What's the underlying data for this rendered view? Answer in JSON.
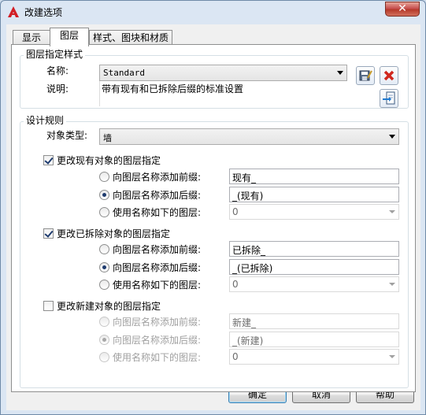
{
  "window": {
    "title": "改建选项",
    "close_glyph": "✕"
  },
  "tabs": [
    {
      "label": "显示"
    },
    {
      "label": "图层"
    },
    {
      "label": "样式、图块和材质"
    }
  ],
  "layer_style": {
    "group_title": "图层指定样式",
    "name_label": "名称:",
    "name_value": "Standard",
    "desc_label": "说明:",
    "desc_value": "带有现有和已拆除后缀的标准设置"
  },
  "rules": {
    "group_title": "设计规则",
    "object_type_label": "对象类型:",
    "object_type_value": "墙",
    "sections": [
      {
        "title": "更改现有对象的图层指定",
        "checked": true,
        "options": [
          {
            "label": "向图层名称添加前缀:",
            "value": "现有_"
          },
          {
            "label": "向图层名称添加后缀:",
            "value": "_(现有)"
          },
          {
            "label": "使用名称如下的图层:",
            "value": "0"
          }
        ]
      },
      {
        "title": "更改已拆除对象的图层指定",
        "checked": true,
        "options": [
          {
            "label": "向图层名称添加前缀:",
            "value": "已拆除_"
          },
          {
            "label": "向图层名称添加后缀:",
            "value": "_(已拆除)"
          },
          {
            "label": "使用名称如下的图层:",
            "value": "0"
          }
        ]
      },
      {
        "title": "更改新建对象的图层指定",
        "checked": false,
        "options": [
          {
            "label": "向图层名称添加前缀:",
            "value": "新建_"
          },
          {
            "label": "向图层名称添加后缀:",
            "value": "_(新建)"
          },
          {
            "label": "使用名称如下的图层:",
            "value": "0"
          }
        ]
      }
    ]
  },
  "buttons": {
    "ok": "确定",
    "cancel": "取消",
    "help": "帮助"
  },
  "icons": {
    "app": "autocad-logo-icon",
    "save": "save-style-icon",
    "delete": "delete-style-icon",
    "import": "import-style-icon"
  },
  "colors": {
    "selected_radio_option": "suffix"
  }
}
